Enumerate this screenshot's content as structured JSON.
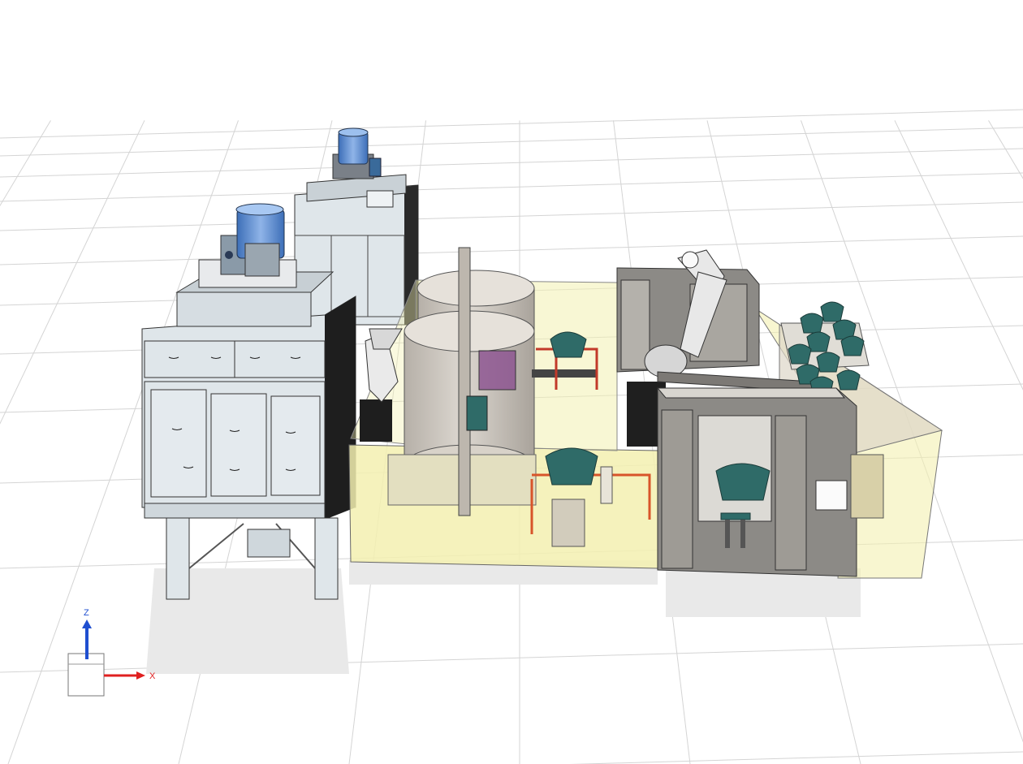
{
  "viewport": {
    "background": "#ffffff",
    "grid_color": "#d4d4d4"
  },
  "axis_triad": {
    "z_label": "Z",
    "x_label": "X",
    "z_color": "#1f4fd0",
    "x_color": "#e02020"
  },
  "colors": {
    "housing": "#dfe6ea",
    "housing_dark": "#aab6bd",
    "motor": "#5b8fd6",
    "enclosure": "#f3f0b0",
    "booth": "#8c8a86",
    "booth_light": "#c9c6c0",
    "tank": "#cfcac4",
    "part_teal": "#2f6b68",
    "fixture_red": "#d8542a",
    "robot": "#e8e8e8"
  },
  "scene": {
    "components": [
      "dust-collector-left",
      "dust-collector-back",
      "motor-left",
      "motor-back",
      "turntable-tank-front",
      "turntable-tank-back",
      "safety-enclosure",
      "robot-arm-left",
      "robot-arm-right",
      "spray-booth-back",
      "spray-booth-front",
      "parts-storage-rack",
      "conveyor",
      "fixture-table"
    ]
  }
}
